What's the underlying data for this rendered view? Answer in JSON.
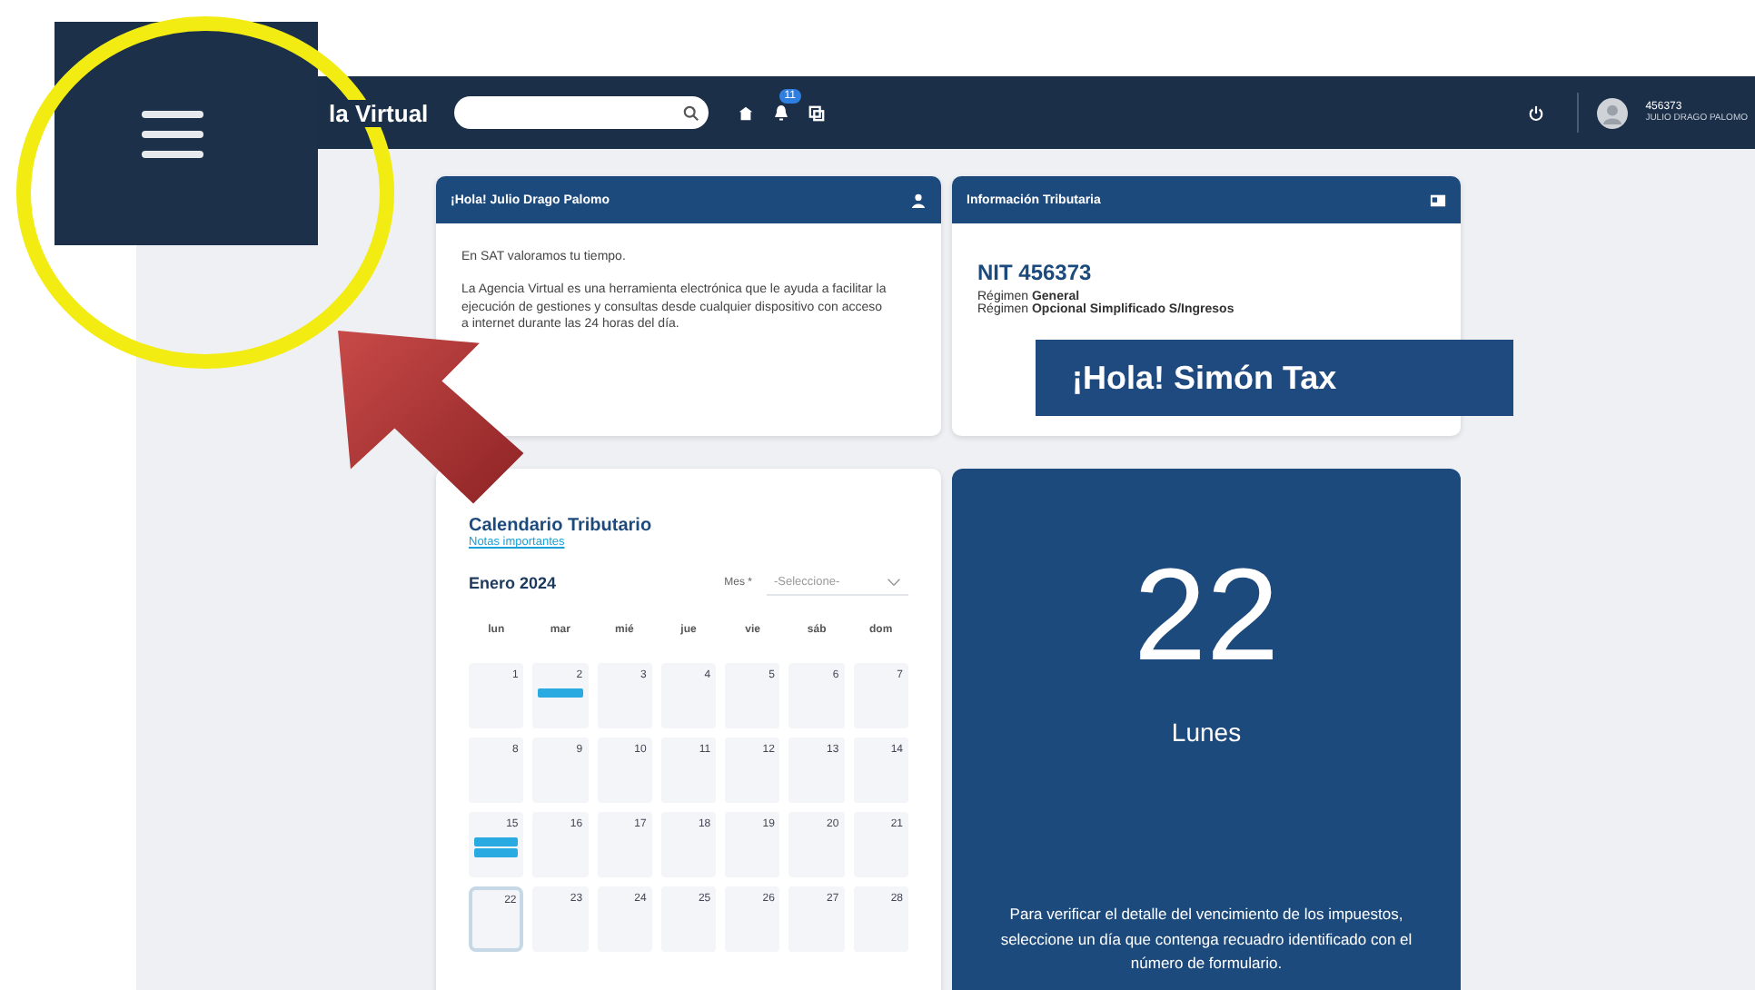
{
  "annotations": {
    "callout_label": "¡Hola! Simón Tax"
  },
  "topbar": {
    "brand": "la Virtual",
    "notification_count": "11",
    "user_id": "456373",
    "user_name": "JULIO DRAGO PALOMO"
  },
  "welcome_card": {
    "title": "¡Hola! Julio Drago Palomo",
    "paragraphs": [
      "En SAT valoramos tu tiempo.",
      "La Agencia Virtual es una herramienta electrónica que le ayuda a facilitar la ejecución de gestiones y consultas desde cualquier dispositivo con acceso a internet durante las 24 horas del día."
    ]
  },
  "tax_info_card": {
    "title": "Información Tributaria",
    "nit": "NIT 456373",
    "regimes": [
      "Régimen **General**",
      "Régimen **Opcional Simplificado S/Ingresos**"
    ]
  },
  "calendar": {
    "title": "Calendario Tributario",
    "link": "Notas importantes",
    "month": "Enero 2024",
    "filter_label": "Mes *",
    "filter_placeholder": "-Seleccione-",
    "weekdays": [
      "lun",
      "mar",
      "mié",
      "jue",
      "vie",
      "sáb",
      "dom"
    ],
    "days": [
      {
        "label": "1",
        "selected": false
      },
      {
        "label": "2",
        "selected": false,
        "events": [
          {
            "color": "#29abe2"
          }
        ]
      },
      {
        "label": "3",
        "selected": false
      },
      {
        "label": "4",
        "selected": false
      },
      {
        "label": "5",
        "selected": false
      },
      {
        "label": "6",
        "selected": false
      },
      {
        "label": "7",
        "selected": false
      },
      {
        "label": "8",
        "selected": false
      },
      {
        "label": "9",
        "selected": false
      },
      {
        "label": "10",
        "selected": false
      },
      {
        "label": "11",
        "selected": false
      },
      {
        "label": "12",
        "selected": false
      },
      {
        "label": "13",
        "selected": false
      },
      {
        "label": "14",
        "selected": false
      },
      {
        "label": "15",
        "selected": false,
        "events": [
          {
            "color": "#29abe2"
          },
          {
            "color": "#29abe2"
          }
        ]
      },
      {
        "label": "16",
        "selected": false
      },
      {
        "label": "17",
        "selected": false
      },
      {
        "label": "18",
        "selected": false
      },
      {
        "label": "19",
        "selected": false
      },
      {
        "label": "20",
        "selected": false
      },
      {
        "label": "21",
        "selected": false
      },
      {
        "label": "22",
        "selected": true
      },
      {
        "label": "23",
        "selected": false
      },
      {
        "label": "24",
        "selected": false
      },
      {
        "label": "25",
        "selected": false
      },
      {
        "label": "26",
        "selected": false
      },
      {
        "label": "27",
        "selected": false
      },
      {
        "label": "28",
        "selected": false
      }
    ]
  },
  "date_panel": {
    "day": "22",
    "weekday": "Lunes",
    "note": "Para verificar el detalle del vencimiento de los impuestos, seleccione un día que contenga recuadro identificado con el número de formulario."
  }
}
